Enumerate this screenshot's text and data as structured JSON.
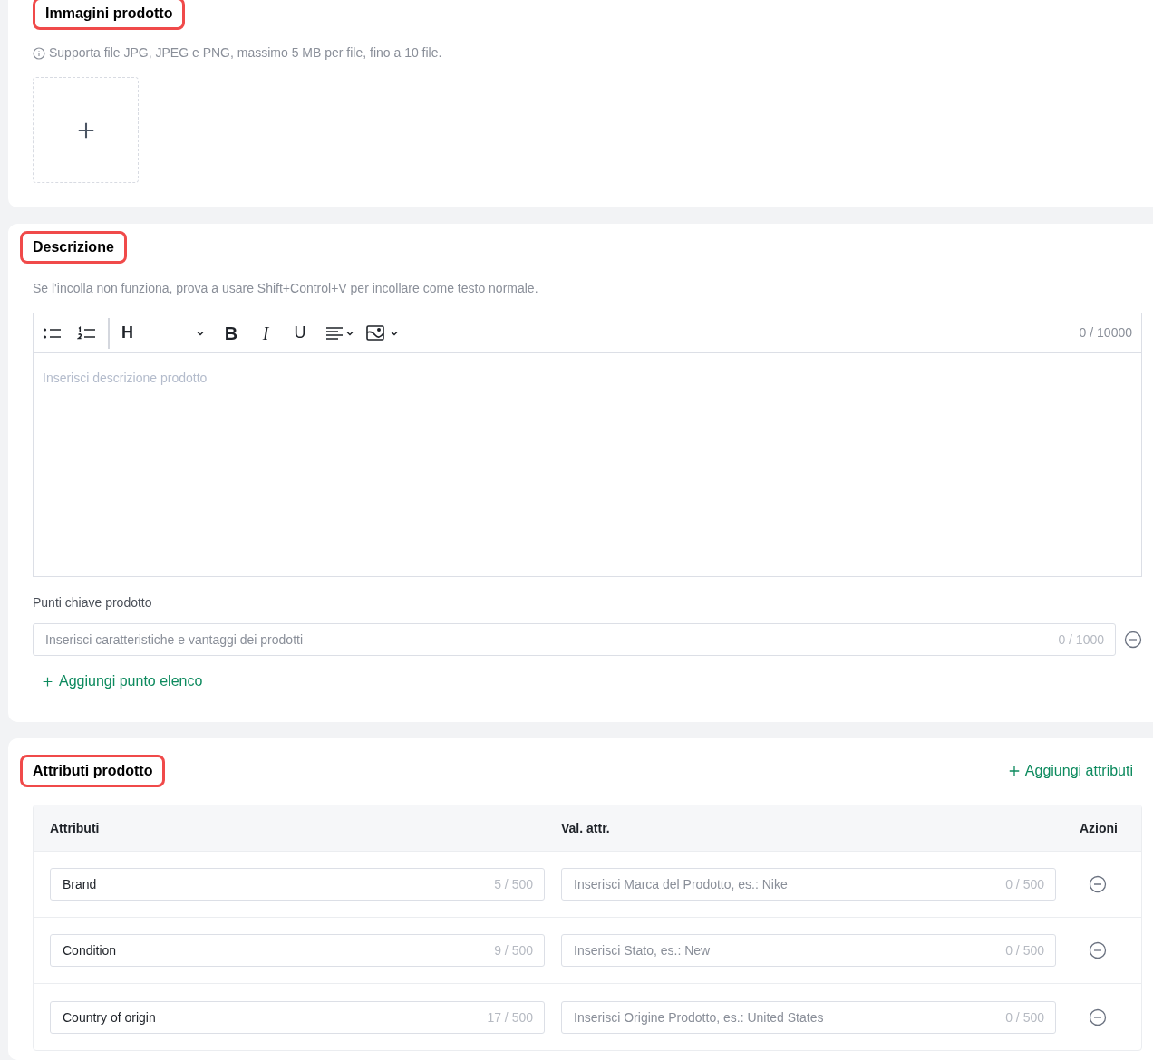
{
  "images": {
    "title": "Immagini prodotto",
    "hint": "Supporta file JPG, JPEG e PNG, massimo 5 MB per file, fino a 10 file."
  },
  "description": {
    "title": "Descrizione",
    "hint": "Se l'incolla non funziona, prova a usare Shift+Control+V per incollare come testo normale.",
    "toolbar": [
      {
        "kind": "bullet-list"
      },
      {
        "kind": "numbered-list"
      },
      {
        "kind": "heading",
        "label": "H"
      },
      {
        "kind": "bold",
        "label": "B"
      },
      {
        "kind": "italic",
        "label": "I"
      },
      {
        "kind": "underline",
        "label": "U"
      },
      {
        "kind": "align"
      },
      {
        "kind": "image"
      }
    ],
    "counter": "0 / 10000",
    "placeholder": "Inserisci descrizione prodotto"
  },
  "key_points": {
    "label": "Punti chiave prodotto",
    "items": [
      {
        "placeholder": "Inserisci caratteristiche e vantaggi dei prodotti",
        "counter": "0 / 1000"
      }
    ],
    "add_link": "Aggiungi punto elenco"
  },
  "attributes": {
    "title": "Attributi prodotto",
    "add_link": "Aggiungi attributi",
    "columns": [
      "Attributi",
      "Val. attr.",
      "Azioni"
    ],
    "rows": [
      {
        "name": "Brand",
        "name_counter": "5 / 500",
        "value_placeholder": "Inserisci Marca del Prodotto, es.: Nike",
        "value_counter": "0 / 500"
      },
      {
        "name": "Condition",
        "name_counter": "9 / 500",
        "value_placeholder": "Inserisci Stato, es.: New",
        "value_counter": "0 / 500"
      },
      {
        "name": "Country of origin",
        "name_counter": "17 / 500",
        "value_placeholder": "Inserisci Origine Prodotto, es.: United States",
        "value_counter": "0 / 500"
      }
    ]
  }
}
